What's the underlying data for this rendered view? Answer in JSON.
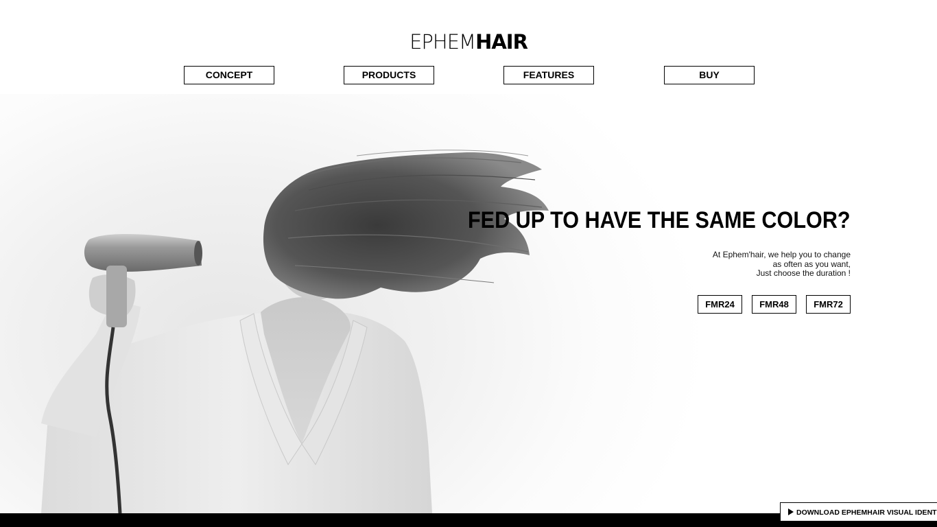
{
  "brand": {
    "logo_light": "EPHEM",
    "logo_bold": "HAIR"
  },
  "nav": {
    "items": [
      {
        "label": "CONCEPT"
      },
      {
        "label": "PRODUCTS"
      },
      {
        "label": "FEATURES"
      },
      {
        "label": "BUY"
      }
    ]
  },
  "hero": {
    "headline": "FED UP TO HAVE THE SAME COLOR?",
    "subtext_lines": [
      "At Ephem'hair, we help you to change",
      "as often as you want,",
      "Just choose the duration !"
    ],
    "products": [
      {
        "label": "FMR24"
      },
      {
        "label": "FMR48"
      },
      {
        "label": "FMR72"
      }
    ]
  },
  "footer": {
    "download_label": "DOWNLOAD EPHEMHAIR VISUAL IDENTITY",
    "download_icon": "play-icon"
  }
}
